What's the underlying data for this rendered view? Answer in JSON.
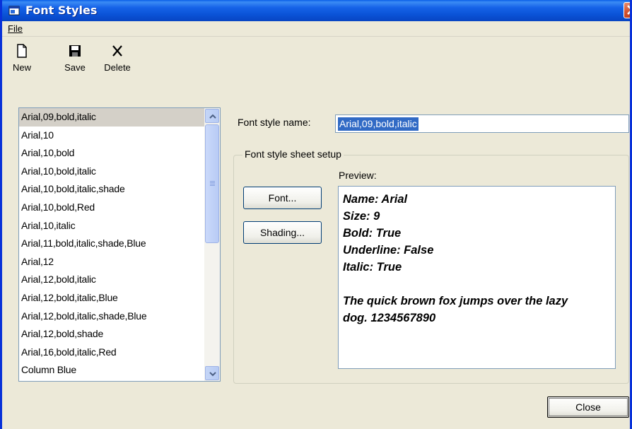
{
  "window": {
    "title": "Font Styles",
    "icons": {
      "app": "app-window-icon",
      "close": "close-x-icon"
    }
  },
  "menu": {
    "file": "File"
  },
  "toolbar": {
    "new": {
      "label": "New",
      "icon": "new-document-icon"
    },
    "save": {
      "label": "Save",
      "icon": "floppy-disk-icon"
    },
    "delete": {
      "label": "Delete",
      "icon": "delete-x-icon"
    }
  },
  "styles_list": {
    "items": [
      "Arial,09,bold,italic",
      "Arial,10",
      "Arial,10,bold",
      "Arial,10,bold,italic",
      "Arial,10,bold,italic,shade",
      "Arial,10,bold,Red",
      "Arial,10,italic",
      "Arial,11,bold,italic,shade,Blue",
      "Arial,12",
      "Arial,12,bold,italic",
      "Arial,12,bold,italic,Blue",
      "Arial,12,bold,italic,shade,Blue",
      "Arial,12,bold,shade",
      "Arial,16,bold,italic,Red",
      "Column Blue"
    ],
    "selected_index": 0
  },
  "form": {
    "name_label": "Font style name:",
    "name_value": "Arial,09,bold,italic",
    "group_title": "Font style sheet setup",
    "font_button": "Font...",
    "shading_button": "Shading...",
    "preview_label": "Preview:",
    "preview_lines": [
      "Name: Arial",
      "Size: 9",
      "Bold: True",
      "Underline: False",
      "Italic: True",
      "",
      "The quick brown fox jumps over the lazy",
      "dog. 1234567890"
    ]
  },
  "footer": {
    "close_button": "Close"
  },
  "colors": {
    "titlebar": "#0a52d6",
    "selection": "#316ac5",
    "window_bg": "#ece9d8"
  }
}
